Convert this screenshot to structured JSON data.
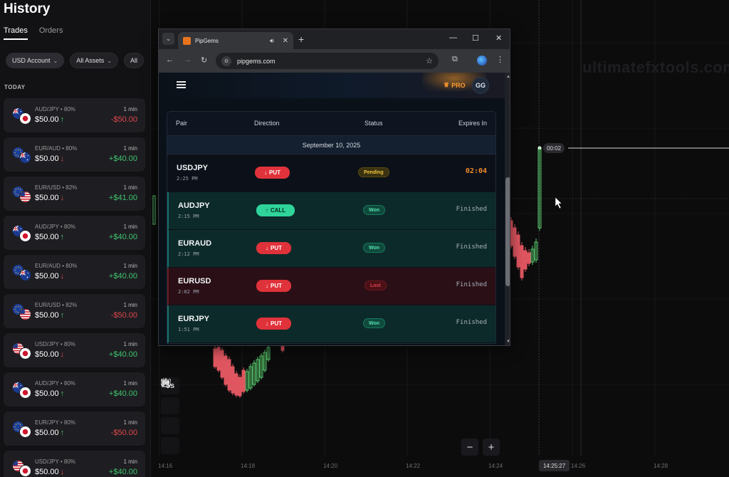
{
  "history": {
    "title": "History",
    "tabs": [
      {
        "label": "Trades",
        "active": true
      },
      {
        "label": "Orders",
        "active": false
      }
    ],
    "filters": [
      "USD Account",
      "All Assets",
      "All"
    ],
    "section": "TODAY",
    "trades": [
      {
        "pair": "AUD/JPY • 80%",
        "amount": "$50.00",
        "dir": "up",
        "duration": "1 min",
        "pnl": "-$50.00",
        "result": "loss",
        "flags": [
          "au",
          "jp"
        ]
      },
      {
        "pair": "EUR/AUD • 80%",
        "amount": "$50.00",
        "dir": "down",
        "duration": "1 min",
        "pnl": "+$40.00",
        "result": "win",
        "flags": [
          "eu",
          "au"
        ]
      },
      {
        "pair": "EUR/USD • 82%",
        "amount": "$50.00",
        "dir": "down",
        "duration": "1 min",
        "pnl": "+$41.00",
        "result": "win",
        "flags": [
          "eu",
          "us"
        ]
      },
      {
        "pair": "AUD/JPY • 80%",
        "amount": "$50.00",
        "dir": "up",
        "duration": "1 min",
        "pnl": "+$40.00",
        "result": "win",
        "flags": [
          "au",
          "jp"
        ]
      },
      {
        "pair": "EUR/AUD • 80%",
        "amount": "$50.00",
        "dir": "down",
        "duration": "1 min",
        "pnl": "+$40.00",
        "result": "win",
        "flags": [
          "eu",
          "au"
        ]
      },
      {
        "pair": "EUR/USD • 82%",
        "amount": "$50.00",
        "dir": "up",
        "duration": "1 min",
        "pnl": "-$50.00",
        "result": "loss",
        "flags": [
          "eu",
          "us"
        ]
      },
      {
        "pair": "USD/JPY • 80%",
        "amount": "$50.00",
        "dir": "down",
        "duration": "1 min",
        "pnl": "+$40.00",
        "result": "win",
        "flags": [
          "us",
          "jp"
        ]
      },
      {
        "pair": "AUD/JPY • 80%",
        "amount": "$50.00",
        "dir": "up",
        "duration": "1 min",
        "pnl": "+$40.00",
        "result": "win",
        "flags": [
          "au",
          "jp"
        ]
      },
      {
        "pair": "EUR/JPY • 80%",
        "amount": "$50.00",
        "dir": "up",
        "duration": "1 min",
        "pnl": "-$50.00",
        "result": "loss",
        "flags": [
          "eu",
          "jp"
        ]
      },
      {
        "pair": "USD/JPY • 80%",
        "amount": "$50.00",
        "dir": "down",
        "duration": "1 min",
        "pnl": "+$40.00",
        "result": "win",
        "flags": [
          "us",
          "jp"
        ]
      }
    ]
  },
  "chart": {
    "watermark": "ultimatefxtools.com",
    "time_labels": [
      "14:16",
      "14:18",
      "14:20",
      "14:22",
      "14:24",
      "14:26",
      "14:28"
    ],
    "current_time": "14:25:27",
    "timer_badge": "00:02",
    "timeframe": "5s",
    "zoom_out": "−",
    "zoom_in": "+"
  },
  "browser": {
    "tab_title": "PipGems",
    "url": "pipgems.com",
    "new_tab": "+",
    "window_controls": {
      "minimize": "—",
      "maximize": "☐",
      "close": "✕"
    }
  },
  "app": {
    "pro_label": "PRO",
    "avatar": "GG",
    "columns": {
      "pair": "Pair",
      "direction": "Direction",
      "status": "Status",
      "expires": "Expires In"
    },
    "date": "September 10, 2025",
    "signals": [
      {
        "pair": "USDJPY",
        "time": "2:25 PM",
        "direction": "PUT",
        "status": "Pending",
        "expires": "02:04"
      },
      {
        "pair": "AUDJPY",
        "time": "2:15 PM",
        "direction": "CALL",
        "status": "Won",
        "expires": "Finished"
      },
      {
        "pair": "EURAUD",
        "time": "2:12 PM",
        "direction": "PUT",
        "status": "Won",
        "expires": "Finished"
      },
      {
        "pair": "EURUSD",
        "time": "2:02 PM",
        "direction": "PUT",
        "status": "Lost",
        "expires": "Finished"
      },
      {
        "pair": "EURJPY",
        "time": "1:51 PM",
        "direction": "PUT",
        "status": "Won",
        "expires": "Finished"
      }
    ]
  }
}
